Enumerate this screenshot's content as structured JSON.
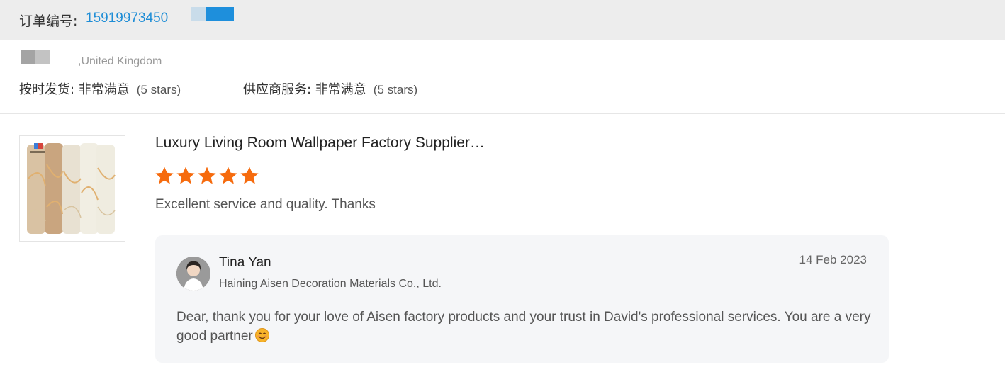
{
  "order": {
    "label": "订单编号: ",
    "number": "15919973450"
  },
  "buyer": {
    "country": ",United Kingdom"
  },
  "ratings": [
    {
      "label": "按时发货: 非常满意",
      "detail": "(5 stars)"
    },
    {
      "label": "供应商服务: 非常满意",
      "detail": "(5 stars)"
    }
  ],
  "review": {
    "product_title": "Luxury Living Room Wallpaper Factory Supplier…",
    "star_rating": 5,
    "star_max": 5,
    "star_color": "#f66b0e",
    "comment": "Excellent service and quality. Thanks"
  },
  "reply": {
    "name": "Tina Yan",
    "company": "Haining Aisen Decoration Materials Co., Ltd.",
    "date": "14 Feb 2023",
    "text": "Dear, thank you for your love of Aisen factory products and your trust in David's professional services. You are a very good partner",
    "emoji_icon": "smiling-face-icon"
  },
  "colors": {
    "link": "#1e8dd6",
    "order_bar_bg": "#ededed",
    "reply_bg": "#f5f6f8"
  }
}
